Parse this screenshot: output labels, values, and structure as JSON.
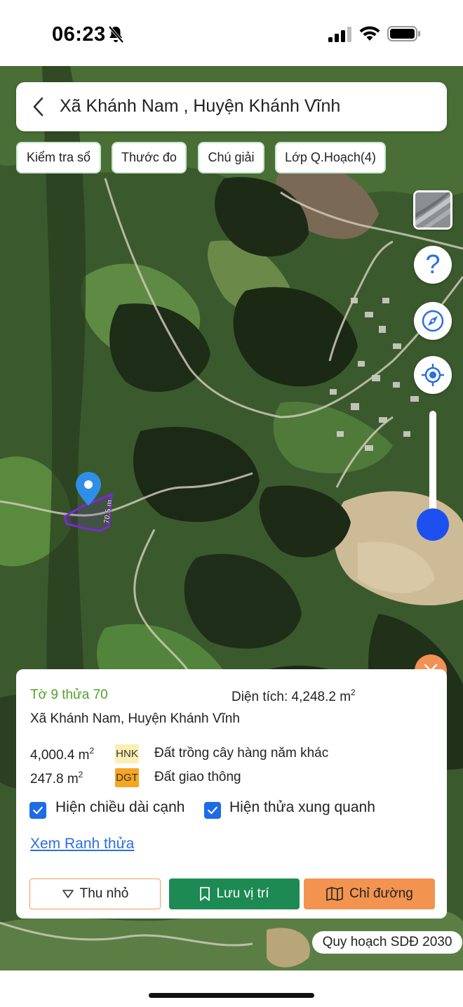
{
  "status_bar": {
    "time": "06:23"
  },
  "header": {
    "title": "Xã Khánh Nam , Huyện Khánh Vĩnh"
  },
  "toolbar": {
    "check_book": "Kiểm tra sổ",
    "ruler": "Thước đo",
    "legend": "Chú giải",
    "planning_layers": "Lớp Q.Hoạch(4)"
  },
  "map": {
    "edge_length_label": "70.5 m",
    "zoom_level_fraction": 0.8,
    "parcel_color": "#7a2ad6",
    "pin_color": "#2f8fe8"
  },
  "controls": {
    "help_glyph": "?"
  },
  "info": {
    "parcel_id": "Tờ 9 thửa 70",
    "area_prefix": "Diện tích: 4,248.2 m",
    "area_exp": "2",
    "address": "Xã Khánh Nam, Huyện Khánh Vĩnh",
    "land_uses": [
      {
        "area": "4,000.4 m",
        "exp": "2",
        "code": "HNK",
        "code_color": "#fcefb4",
        "name": "Đất trồng cây hàng năm khác"
      },
      {
        "area": "247.8 m",
        "exp": "2",
        "code": "DGT",
        "code_color": "#f5a623",
        "name": "Đất giao thông"
      }
    ],
    "show_edge_length": "Hiện chiều dài cạnh",
    "show_neighbors": "Hiện thửa xung quanh",
    "view_boundary": "Xem Ranh thửa",
    "collapse": "Thu nhỏ",
    "save_location": "Lưu vị trí",
    "directions": "Chỉ đường"
  },
  "plan_badge": "Quy hoạch SDĐ 2030",
  "colors": {
    "accent_blue": "#1e50f0",
    "save_green": "#1c8a52",
    "route_orange": "#f2944f",
    "close_orange": "#f19155"
  }
}
